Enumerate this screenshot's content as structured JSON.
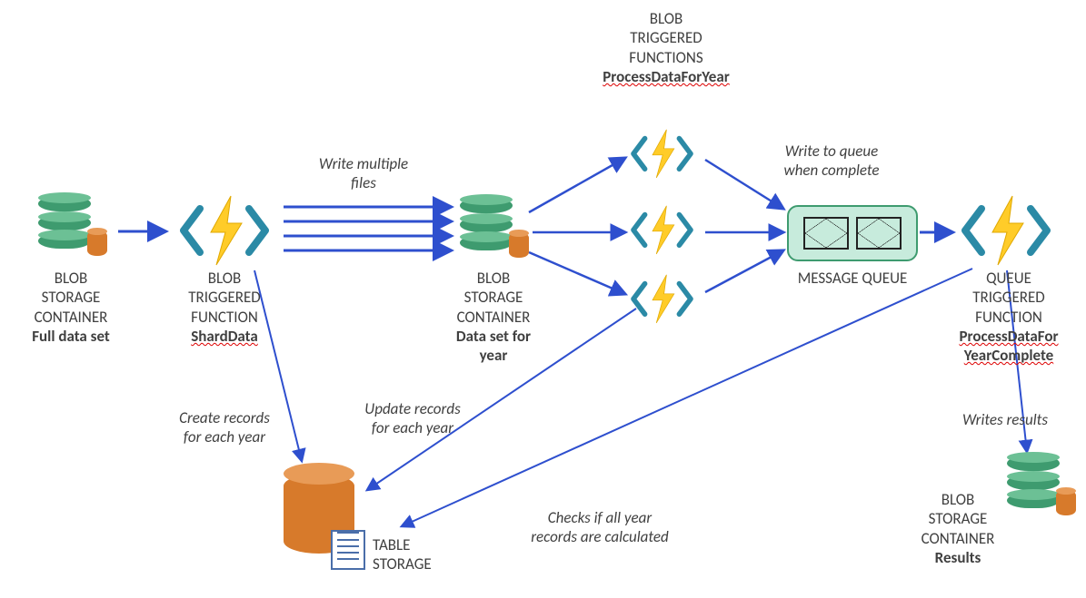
{
  "nodes": {
    "blob_full": {
      "line1": "BLOB",
      "line2": "STORAGE",
      "line3": "CONTAINER",
      "sub": "Full data set"
    },
    "fn_shard": {
      "line1": "BLOB",
      "line2": "TRIGGERED",
      "line3": "FUNCTION",
      "sub": "ShardData"
    },
    "blob_year": {
      "line1": "BLOB",
      "line2": "STORAGE",
      "line3": "CONTAINER",
      "sub": "Data set for",
      "sub2": "year"
    },
    "fn_process": {
      "line1": "BLOB",
      "line2": "TRIGGERED",
      "line3": "FUNCTIONS",
      "sub": "ProcessDataForYear"
    },
    "queue": {
      "label": "MESSAGE QUEUE"
    },
    "fn_complete": {
      "line1": "QUEUE",
      "line2": "TRIGGERED",
      "line3": "FUNCTION",
      "sub": "ProcessDataFor",
      "sub2": "YearComplete"
    },
    "table": {
      "label": "TABLE",
      "label2": "STORAGE"
    },
    "blob_results": {
      "line1": "BLOB",
      "line2": "STORAGE",
      "line3": "CONTAINER",
      "sub": "Results"
    }
  },
  "edges": {
    "write_multi": "Write multiple\nfiles",
    "write_queue": "Write to queue\nwhen complete",
    "create_rec": "Create records\nfor each year",
    "update_rec": "Update records\nfor each year",
    "checks": "Checks if all year\nrecords are calculated",
    "writes_res": "Writes results"
  }
}
